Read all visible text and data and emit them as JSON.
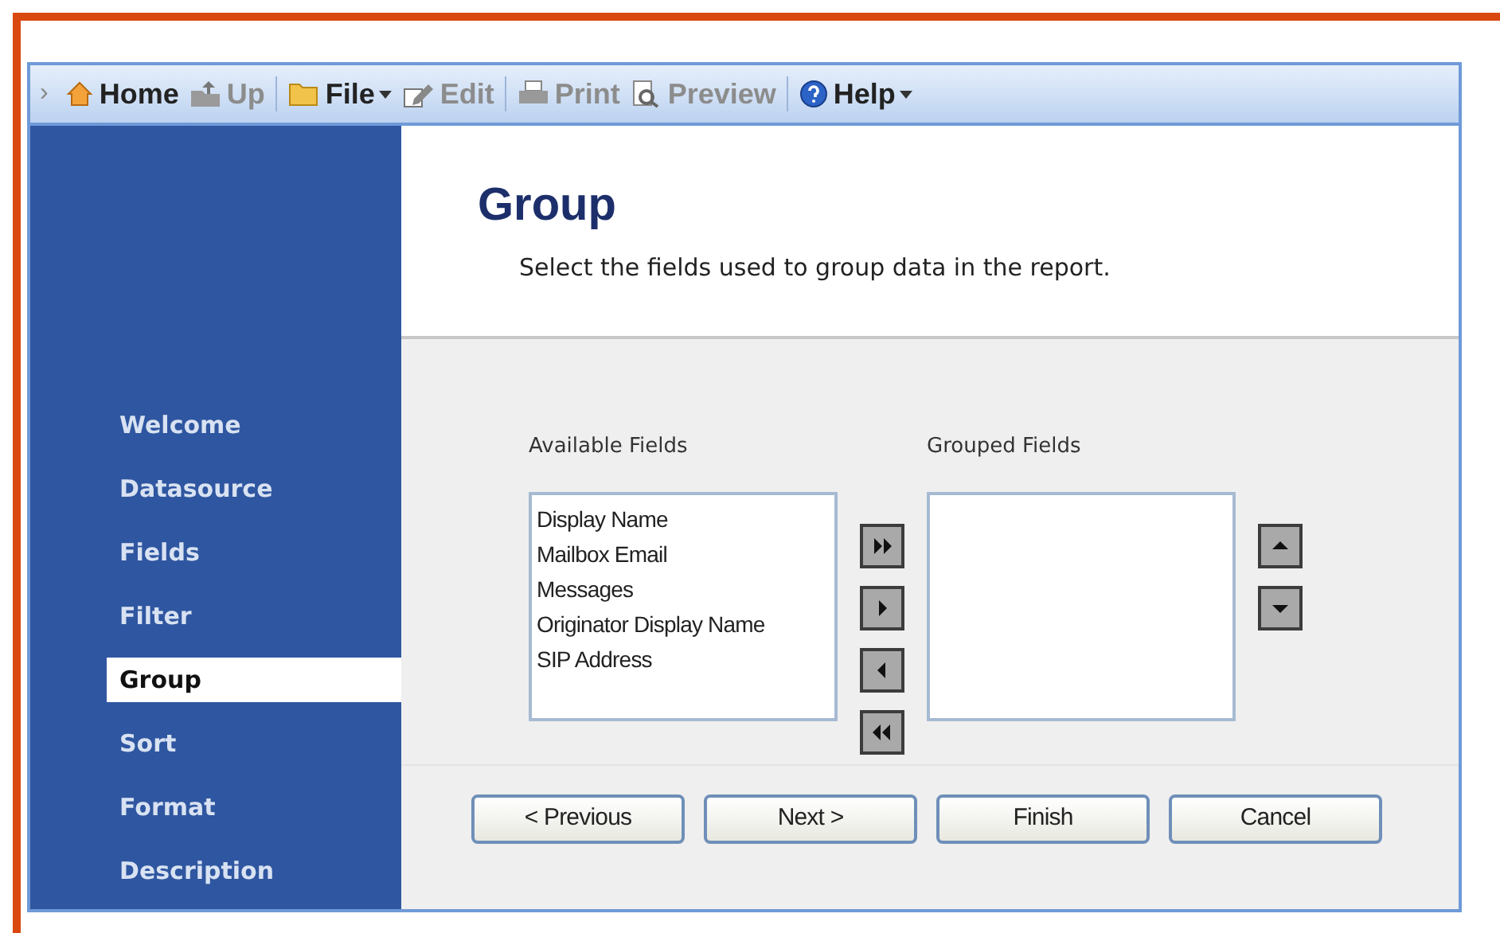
{
  "toolbar": {
    "chevron": "›",
    "items": [
      {
        "kind": "home",
        "label": "Home",
        "disabled": false,
        "dropdown": false
      },
      {
        "kind": "up",
        "label": "Up",
        "disabled": true,
        "dropdown": false
      },
      {
        "kind": "file",
        "label": "File",
        "disabled": false,
        "dropdown": true
      },
      {
        "kind": "edit",
        "label": "Edit",
        "disabled": true,
        "dropdown": false
      },
      {
        "kind": "print",
        "label": "Print",
        "disabled": true,
        "dropdown": false
      },
      {
        "kind": "preview",
        "label": "Preview",
        "disabled": true,
        "dropdown": false
      },
      {
        "kind": "help",
        "label": "Help",
        "disabled": false,
        "dropdown": true
      }
    ]
  },
  "sidebar": {
    "items": [
      {
        "label": "Welcome",
        "selected": false
      },
      {
        "label": "Datasource",
        "selected": false
      },
      {
        "label": "Fields",
        "selected": false
      },
      {
        "label": "Filter",
        "selected": false
      },
      {
        "label": "Group",
        "selected": true
      },
      {
        "label": "Sort",
        "selected": false
      },
      {
        "label": "Format",
        "selected": false
      },
      {
        "label": "Description",
        "selected": false
      }
    ]
  },
  "header": {
    "title": "Group",
    "subtitle": "Select the fields used to group data in the report."
  },
  "available": {
    "label": "Available Fields",
    "items": [
      "Display Name",
      "Mailbox Email",
      "Messages",
      "Originator Display Name",
      "SIP Address"
    ]
  },
  "move_buttons": [
    {
      "kind": "all-right"
    },
    {
      "kind": "right"
    },
    {
      "kind": "left"
    },
    {
      "kind": "all-left"
    }
  ],
  "grouped": {
    "label": "Grouped Fields"
  },
  "order_buttons": [
    {
      "kind": "up"
    },
    {
      "kind": "down"
    }
  ],
  "buttons": [
    "< Previous",
    "Next >",
    "Finish",
    "Cancel"
  ]
}
